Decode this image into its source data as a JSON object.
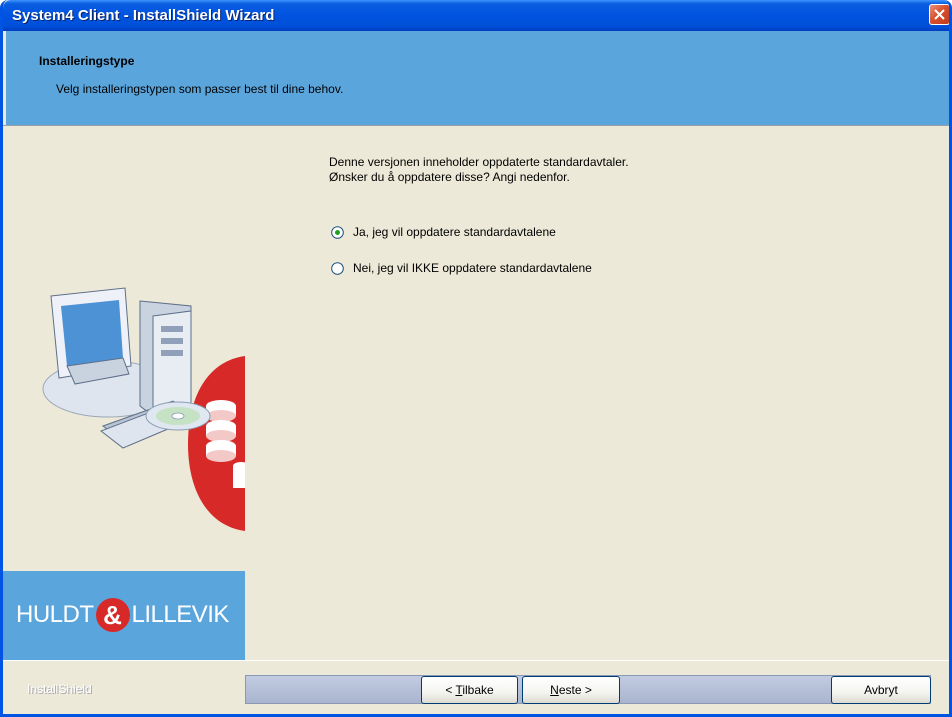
{
  "window": {
    "title": "System4 Client - InstallShield Wizard"
  },
  "header": {
    "title": "Installeringstype",
    "subtitle": "Velg installeringstypen som passer best til dine behov."
  },
  "content": {
    "intro_line1": "Denne versjonen inneholder oppdaterte standardavtaler.",
    "intro_line2": "Ønsker du å oppdatere disse? Angi nedenfor.",
    "options": [
      {
        "label": "Ja, jeg vil oppdatere standardavtalene",
        "selected": true
      },
      {
        "label": "Nei, jeg vil IKKE oppdatere standardavtalene",
        "selected": false
      }
    ]
  },
  "brand": {
    "left": "HULDT",
    "amp": "&",
    "right": "LILLEVIK"
  },
  "footer": {
    "installshield": "InstallShield",
    "back_prefix": "< ",
    "back_accel": "T",
    "back_rest": "ilbake",
    "next_accel": "N",
    "next_rest": "este >",
    "cancel": "Avbryt"
  },
  "icons": {
    "close": "close-icon",
    "computer": "computer-cd-database-illustration"
  },
  "colors": {
    "title_bar": "#0053e1",
    "header_band": "#5ba5dd",
    "brand_red": "#d72a28",
    "dialog_bg": "#ece9d8"
  }
}
